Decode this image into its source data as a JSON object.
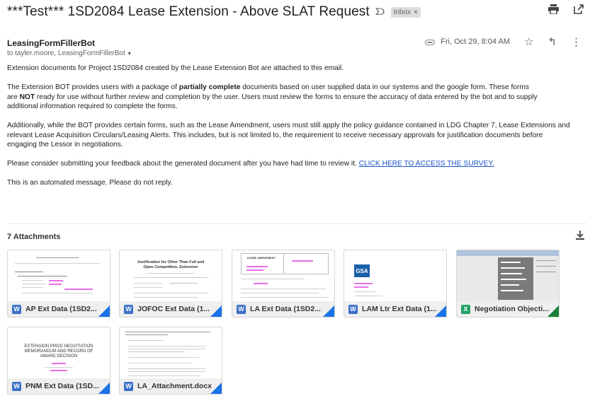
{
  "header": {
    "subject": "***Test*** 1SD2084 Lease Extension - Above SLAT Request",
    "important_icon": "importance-marker-icon",
    "label": "Inbox",
    "label_close": "×",
    "icons": [
      "print-icon",
      "open-in-new-window-icon"
    ]
  },
  "message": {
    "sender": "LeasingFormFillerBot",
    "recipients": "to tayler.moore, LeasingFormFillerBot",
    "recipients_caret": "▾",
    "date": "Fri, Oct 29, 8:04 AM",
    "icons": [
      "attachment-icon",
      "star-icon",
      "reply-icon",
      "more-icon"
    ]
  },
  "body": {
    "p1": "Extension documents for Project 1SD2084 created by the Lease Extension Bot are attached to this email.",
    "p2_a": "The Extension BOT provides users with a package of ",
    "p2_bold1": "partially complete",
    "p2_b": " documents based on user supplied data in our systems and the google form.  These forms\nare ",
    "p2_bold2": "NOT",
    "p2_c": " ready for use without further review and completion by the user.  Users must review the forms to ensure the accuracy of data entered by the bot and to supply\nadditional information required to complete the forms.",
    "p3": "Additionally, while the BOT provides certain forms, such as the Lease Amendment, users must still apply the policy guidance contained in LDG Chapter 7, Lease Extensions and\nrelevant Lease Acquisition Circulars/Leasing Alerts.  This includes, but is not limited to, the requirement to receive necessary approvals for justification documents before\nengaging the Lessor in negotiations.",
    "p4": "Please consider submitting your feedback about the generated document after you have had time to review it. ",
    "survey_link": "CLICK HERE TO ACCESS THE SURVEY.",
    "p5": "This is an automated message. Please do not reply."
  },
  "attachments": {
    "title": "7 Attachments",
    "download_icon": "download-all-icon",
    "items": [
      {
        "name": "AP Ext Data (1SD2...",
        "type": "W",
        "kind": "word"
      },
      {
        "name": "JOFOC Ext Data (1...",
        "type": "W",
        "kind": "word",
        "thumb_title": "Justification for Other Than Full and Open Competition, Extension"
      },
      {
        "name": "LA Ext Data (1SD2...",
        "type": "W",
        "kind": "word",
        "thumb_title": "LEASE AMENDMENT"
      },
      {
        "name": "LAM Ltr Ext Data (1...",
        "type": "W",
        "kind": "word",
        "thumb_logo": "GSA"
      },
      {
        "name": "Negotiation Objecti...",
        "type": "X",
        "kind": "excel"
      },
      {
        "name": "PNM Ext Data (1SD...",
        "type": "W",
        "kind": "word",
        "thumb_title": "EXTENSION PRICE NEGOTIATION MEMORANDUM AND RECORD OF AWARD DECISION"
      },
      {
        "name": "LA_Attachment.docx",
        "type": "W",
        "kind": "word"
      }
    ]
  },
  "colors": {
    "link": "#1a55c9",
    "word": "#3b6fc9",
    "excel": "#21a366",
    "corner_blue": "#1a73e8",
    "corner_green": "#188038"
  }
}
